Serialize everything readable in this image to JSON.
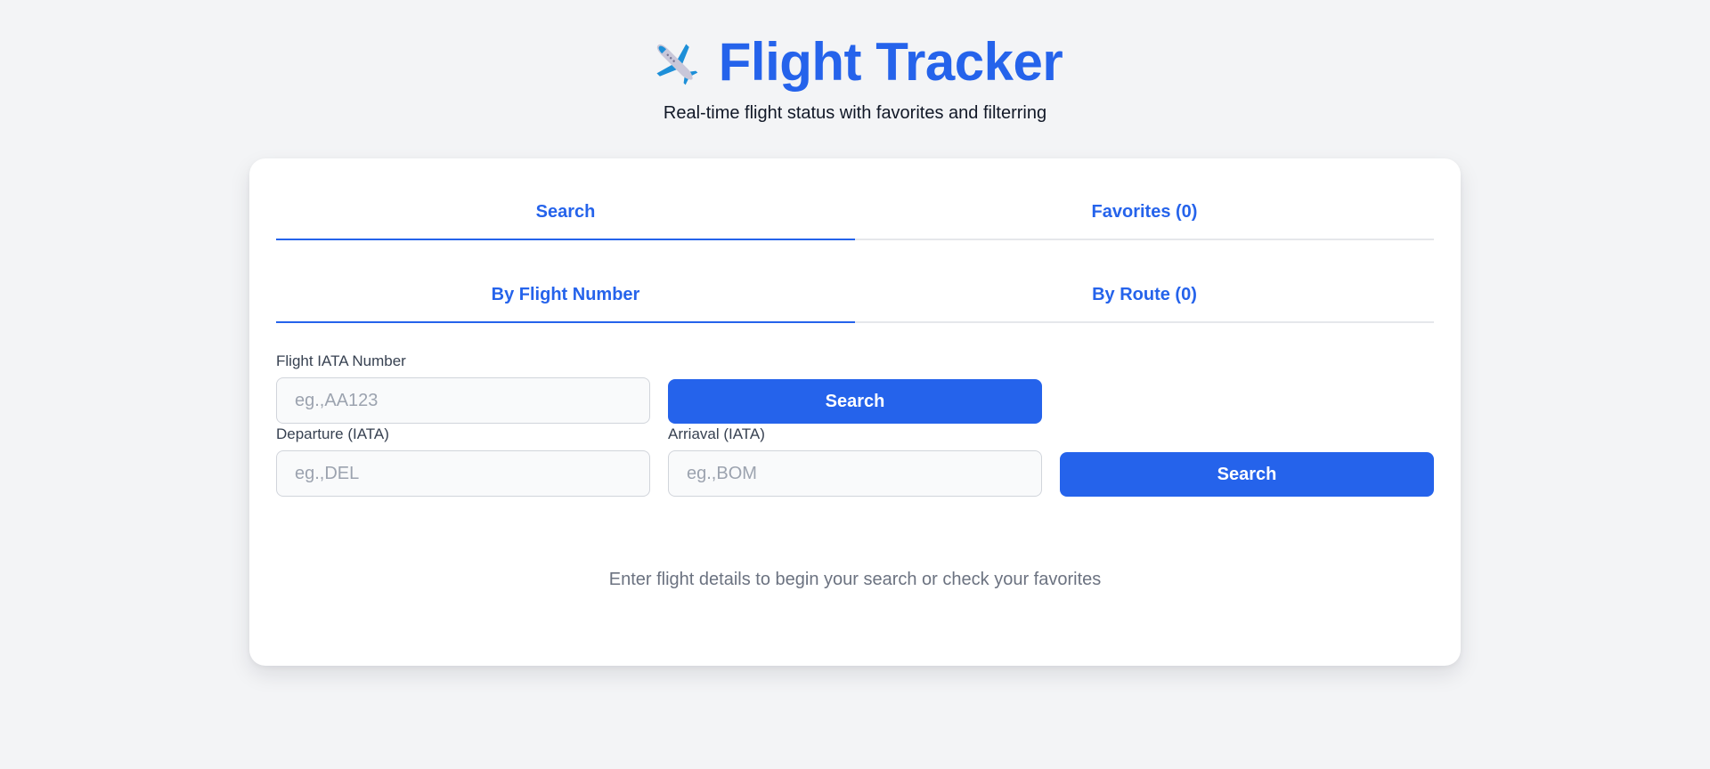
{
  "header": {
    "icon": "airplane-icon",
    "title": "Flight Tracker",
    "subtitle": "Real-time flight status with favorites and filterring"
  },
  "tabs": {
    "search_label": "Search",
    "favorites_label": "Favorites (0)"
  },
  "subtabs": {
    "flight_number_label": "By Flight Number",
    "route_label": "By Route (0)"
  },
  "flight_search": {
    "label": "Flight IATA Number",
    "value": "",
    "placeholder": "eg.,AA123",
    "button_label": "Search"
  },
  "route_search": {
    "departure_label": "Departure (IATA)",
    "departure_value": "",
    "departure_placeholder": "eg.,DEL",
    "arrival_label": "Arriaval (IATA)",
    "arrival_value": "",
    "arrival_placeholder": "eg.,BOM",
    "button_label": "Search"
  },
  "empty_state": "Enter flight details to begin your search or check your favorites",
  "colors": {
    "accent": "#2563eb",
    "background": "#f3f4f6",
    "card": "#ffffff",
    "muted_text": "#6b7280"
  }
}
